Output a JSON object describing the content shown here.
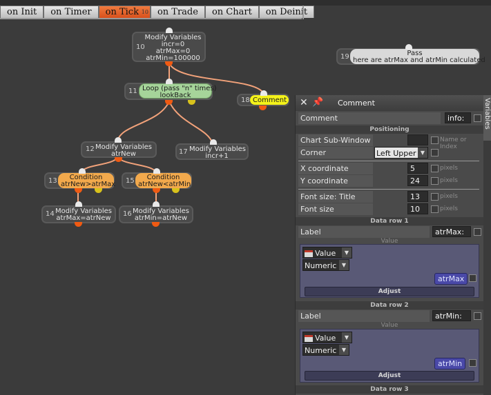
{
  "tabs": [
    {
      "label": "on Init",
      "active": false
    },
    {
      "label": "on Timer",
      "active": false
    },
    {
      "label": "on Tick",
      "active": true,
      "badge": "10"
    },
    {
      "label": "on Trade",
      "active": false
    },
    {
      "label": "on Chart",
      "active": false
    },
    {
      "label": "on Deinit",
      "active": false
    }
  ],
  "nodes": {
    "n10": {
      "num": "10",
      "lines": [
        "Modify Variables",
        "incr=0",
        "atrMax=0",
        "atrMin=100000"
      ]
    },
    "n11": {
      "num": "11",
      "lines": [
        "Loop (pass \"n\" times)",
        "lookBack"
      ]
    },
    "n12": {
      "num": "12",
      "lines": [
        "Modify Variables",
        "atrNew"
      ]
    },
    "n13": {
      "num": "13",
      "lines": [
        "Condition",
        "atrNew>atrMax"
      ]
    },
    "n14": {
      "num": "14",
      "lines": [
        "Modify Variables",
        "atrMax=atrNew"
      ]
    },
    "n15": {
      "num": "15",
      "lines": [
        "Condition",
        "atrNew<atrMin"
      ]
    },
    "n16": {
      "num": "16",
      "lines": [
        "Modify Variables",
        "atrMin=atrNew"
      ]
    },
    "n17": {
      "num": "17",
      "lines": [
        "Modify Variables",
        "incr+1"
      ]
    },
    "n18": {
      "num": "18",
      "lines": [
        "Comment"
      ]
    },
    "n19": {
      "num": "19",
      "lines": [
        "Pass",
        "here are atrMax and atrMin calculated"
      ]
    }
  },
  "panel": {
    "title": "Comment",
    "side_tab": "Variables",
    "name_label": "Comment",
    "name_value": "info:",
    "positioning_header": "Positioning",
    "chart_subwindow_label": "Chart Sub-Window",
    "chart_subwindow_hint": "Name or Index",
    "corner_label": "Corner",
    "corner_value": "Left Upper",
    "x_label": "X coordinate",
    "x_value": "5",
    "y_label": "Y coordinate",
    "y_value": "24",
    "font_title_label": "Font size: Title",
    "font_title_value": "13",
    "font_size_label": "Font size",
    "font_size_value": "10",
    "pixels_hint": "pixels",
    "rows": [
      {
        "header": "Data row 1",
        "label_caption": "Label",
        "label_value": "atrMax:",
        "value_caption": "Value",
        "type": "Value",
        "format": "Numeric",
        "var": "atrMax",
        "adjust": "Adjust"
      },
      {
        "header": "Data row 2",
        "label_caption": "Label",
        "label_value": "atrMin:",
        "value_caption": "Value",
        "type": "Value",
        "format": "Numeric",
        "var": "atrMin",
        "adjust": "Adjust"
      }
    ],
    "row3_header": "Data row 3"
  },
  "colors": {
    "canvas": "#3b3b3b",
    "wire": "#f2a27a",
    "output_dot": "#f05a12",
    "loop_node": "#a6d49a",
    "condition_node": "#f2a94c",
    "comment_node": "#f4f21a",
    "variable_pill": "#4a49a8"
  }
}
